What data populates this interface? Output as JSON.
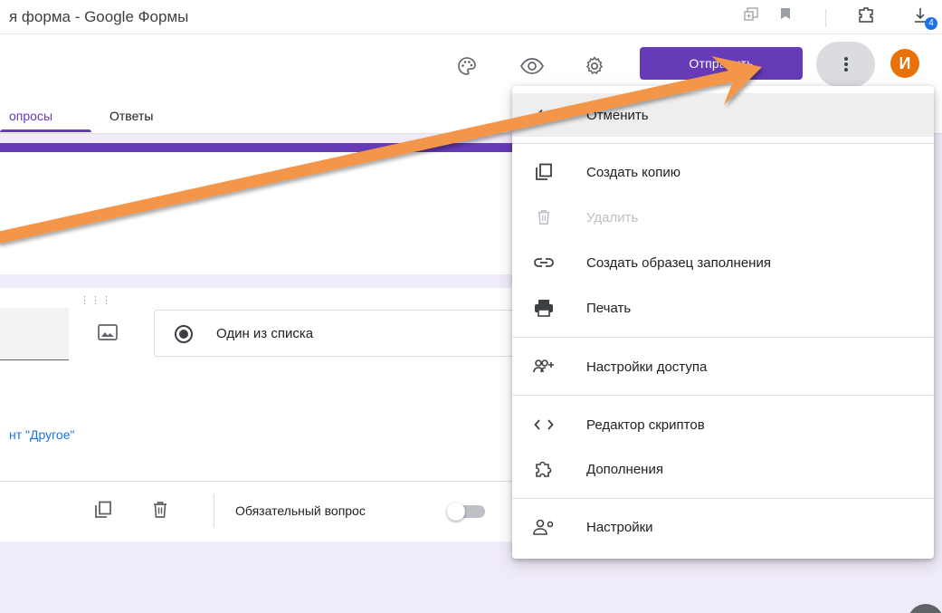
{
  "browser": {
    "tab_title": "я форма - Google Формы",
    "download_count": "4"
  },
  "header": {
    "send_label": "Отправить",
    "avatar_letter": "И",
    "tabs": [
      {
        "label": "опросы",
        "active": true
      },
      {
        "label": "Ответы",
        "active": false
      }
    ],
    "icons": [
      "palette-icon",
      "preview-eye-icon",
      "settings-gear-icon",
      "more-vert-icon"
    ]
  },
  "question": {
    "type_label": "Один из списка",
    "other_option_text": "нт \"Другое\"",
    "required_label": "Обязательный вопрос",
    "required_on": false
  },
  "menu": {
    "items": [
      {
        "label": "Отменить",
        "icon": "undo-arrow-icon",
        "disabled": false,
        "highlighted": true
      },
      {
        "label": "Создать копию",
        "icon": "copy-icon",
        "disabled": false
      },
      {
        "label": "Удалить",
        "icon": "trash-icon",
        "disabled": true
      },
      {
        "label": "Создать образец заполнения",
        "icon": "link-icon",
        "disabled": false
      },
      {
        "label": "Печать",
        "icon": "printer-icon",
        "disabled": false
      },
      {
        "label": "Настройки доступа",
        "icon": "add-people-icon",
        "disabled": false
      },
      {
        "label": "Редактор скриптов",
        "icon": "code-brackets-icon",
        "disabled": false
      },
      {
        "label": "Дополнения",
        "icon": "puzzle-icon",
        "disabled": false
      },
      {
        "label": "Настройки",
        "icon": "person-settings-icon",
        "disabled": false
      }
    ]
  },
  "colors": {
    "brand": "#673ab7",
    "background": "#f0ebf8",
    "avatar": "#e8710a",
    "annotation_arrow": "#f4964a"
  }
}
